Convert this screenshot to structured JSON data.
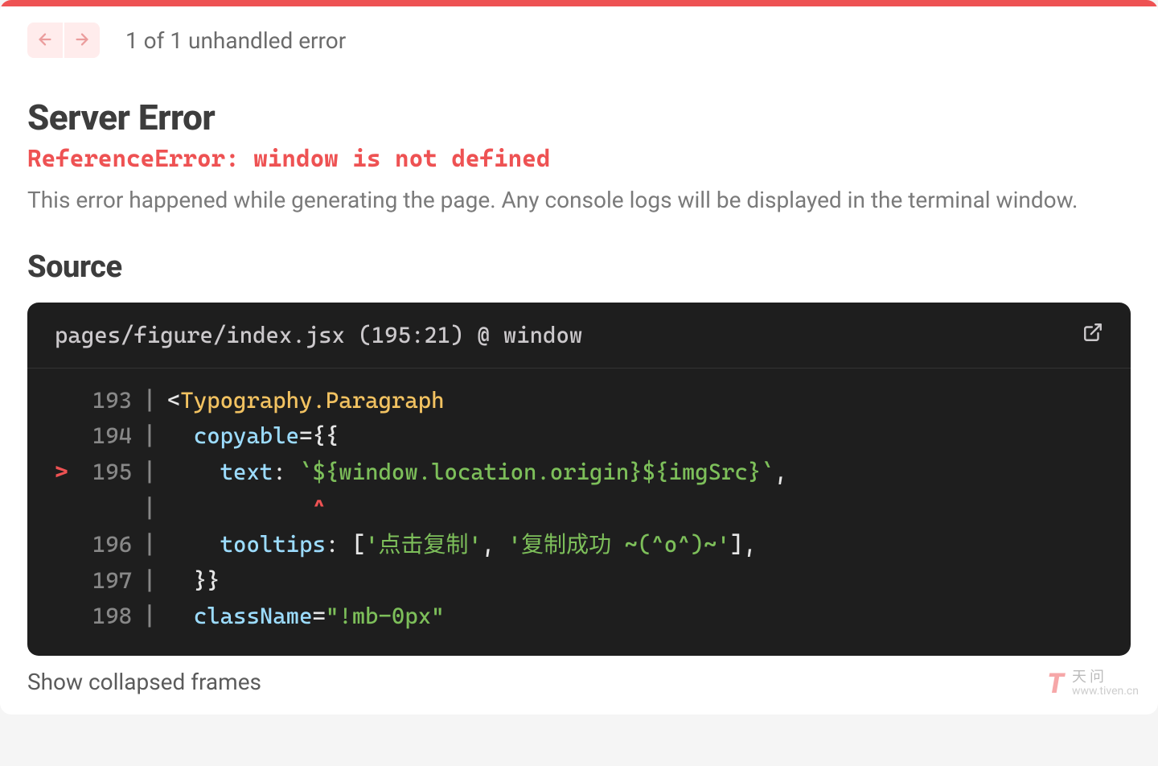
{
  "header": {
    "error_count_text": "1 of 1 unhandled error"
  },
  "error": {
    "title": "Server Error",
    "message": "ReferenceError: window is not defined",
    "description": "This error happened while generating the page. Any console logs will be displayed in the terminal window."
  },
  "source": {
    "heading": "Source",
    "location": "pages/figure/index.jsx (195:21) @ window",
    "error_line": 195,
    "caret_indent": "           ",
    "caret": "^",
    "lines": [
      {
        "n": "193",
        "segments": [
          {
            "t": "<",
            "c": "tok-punc"
          },
          {
            "t": "Typography.Paragraph",
            "c": "tok-tag"
          }
        ]
      },
      {
        "n": "194",
        "segments": [
          {
            "t": "  copyable",
            "c": "tok-attr"
          },
          {
            "t": "=",
            "c": "tok-punc"
          },
          {
            "t": "{{",
            "c": "tok-punc"
          }
        ]
      },
      {
        "n": "195",
        "marker": ">",
        "segments": [
          {
            "t": "    text",
            "c": "tok-attr"
          },
          {
            "t": ": ",
            "c": "tok-punc"
          },
          {
            "t": "`${",
            "c": "tok-str"
          },
          {
            "t": "window.location.origin",
            "c": "tok-str"
          },
          {
            "t": "}${",
            "c": "tok-str"
          },
          {
            "t": "imgSrc",
            "c": "tok-str"
          },
          {
            "t": "}`",
            "c": "tok-str"
          },
          {
            "t": ",",
            "c": "tok-punc"
          }
        ]
      },
      {
        "n": "196",
        "segments": [
          {
            "t": "    tooltips",
            "c": "tok-attr"
          },
          {
            "t": ": [",
            "c": "tok-punc"
          },
          {
            "t": "'点击复制'",
            "c": "tok-str"
          },
          {
            "t": ", ",
            "c": "tok-punc"
          },
          {
            "t": "'复制成功 ~(^o^)~'",
            "c": "tok-str"
          },
          {
            "t": "]",
            "c": "tok-punc"
          },
          {
            "t": ",",
            "c": "tok-punc"
          }
        ]
      },
      {
        "n": "197",
        "segments": [
          {
            "t": "  }}",
            "c": "tok-punc"
          }
        ]
      },
      {
        "n": "198",
        "segments": [
          {
            "t": "  className",
            "c": "tok-attr"
          },
          {
            "t": "=",
            "c": "tok-punc"
          },
          {
            "t": "\"!mb-0px\"",
            "c": "tok-str"
          }
        ]
      }
    ]
  },
  "footer": {
    "show_collapsed": "Show collapsed frames"
  },
  "watermark": {
    "top": "天问",
    "bottom": "www.tiven.cn"
  }
}
